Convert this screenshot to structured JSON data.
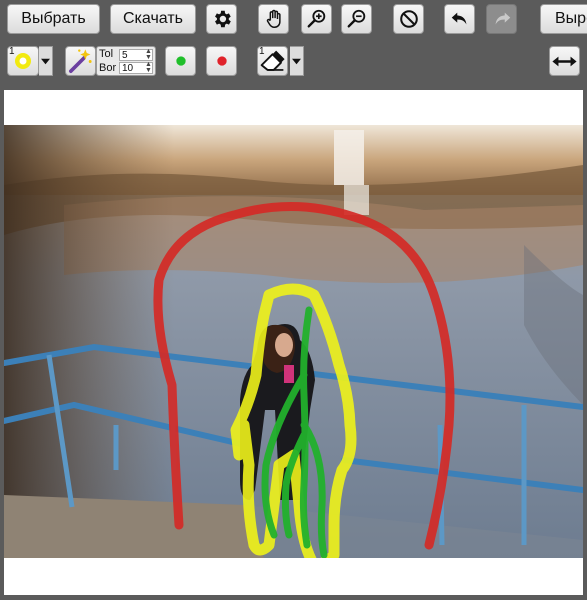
{
  "toolbar": {
    "select_label": "Выбрать",
    "download_label": "Скачать",
    "cut_label_partial": "Выре"
  },
  "brush": {
    "size_badge": "1",
    "eraser_badge": "1"
  },
  "params": {
    "tol_label": "Tol",
    "tol_value": "5",
    "bor_label": "Bor",
    "bor_value": "10"
  },
  "colors": {
    "toolbar_bg": "#5b5b5b",
    "foreground_marker": "#1fbf2a",
    "background_marker": "#e0222a",
    "brush_color": "#f2ea10",
    "red_stroke": "#d42a26",
    "green_stroke": "#22b02c",
    "yellow_stroke": "#eef21a"
  },
  "icons": [
    "settings-gear",
    "hand-pan",
    "zoom-in",
    "zoom-out",
    "cancel",
    "undo",
    "redo",
    "magic-wand",
    "eraser",
    "resize-horizontal"
  ]
}
